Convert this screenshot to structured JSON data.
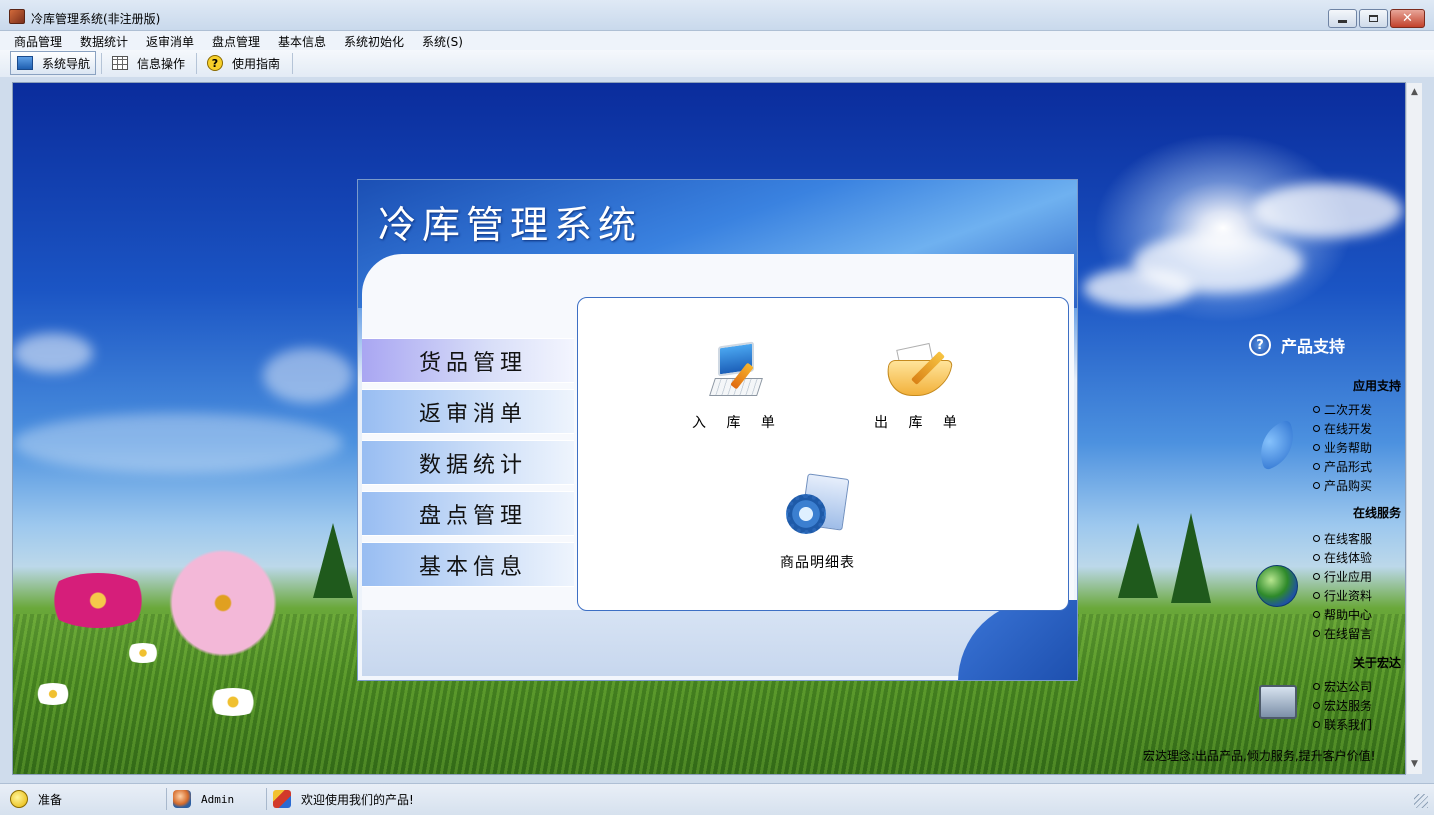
{
  "window": {
    "title": "冷库管理系统(非注册版)",
    "controls": {
      "minimize": "",
      "maximize": "",
      "close": "✕"
    }
  },
  "menu": [
    "商品管理",
    "数据统计",
    "返审消单",
    "盘点管理",
    "基本信息",
    "系统初始化",
    "系统(S)"
  ],
  "toolbar": {
    "items": [
      {
        "label": "系统导航",
        "icon": "monitor-icon",
        "active": true
      },
      {
        "label": "信息操作",
        "icon": "grid-icon",
        "active": false
      },
      {
        "label": "使用指南",
        "icon": "help-icon",
        "active": false
      }
    ]
  },
  "panel": {
    "title": "冷库管理系统",
    "nav": [
      "货品管理",
      "返审消单",
      "数据统计",
      "盘点管理",
      "基本信息"
    ],
    "active_nav": "货品管理",
    "functions": {
      "inbound": "入 库 单",
      "outbound": "出 库 单",
      "detail": "商品明细表"
    }
  },
  "support": {
    "title": "产品支持",
    "sections": [
      {
        "title": "应用支持",
        "links": [
          "二次开发",
          "在线开发",
          "业务帮助",
          "产品形式",
          "产品购买"
        ]
      },
      {
        "title": "在线服务",
        "links": [
          "在线客服",
          "在线体验",
          "行业应用",
          "行业资料",
          "帮助中心",
          "在线留言"
        ]
      },
      {
        "title": "关于宏达",
        "links": [
          "宏达公司",
          "宏达服务",
          "联系我们"
        ]
      }
    ],
    "slogan": "宏达理念:出品产品,倾力服务,提升客户价值!"
  },
  "status": {
    "ready": "准备",
    "user": "Admin",
    "message": "欢迎使用我们的产品!"
  },
  "colors": {
    "accent": "#1d4fae",
    "nav_active": "#a9a6f2",
    "nav_inactive": "#98bdf2"
  }
}
